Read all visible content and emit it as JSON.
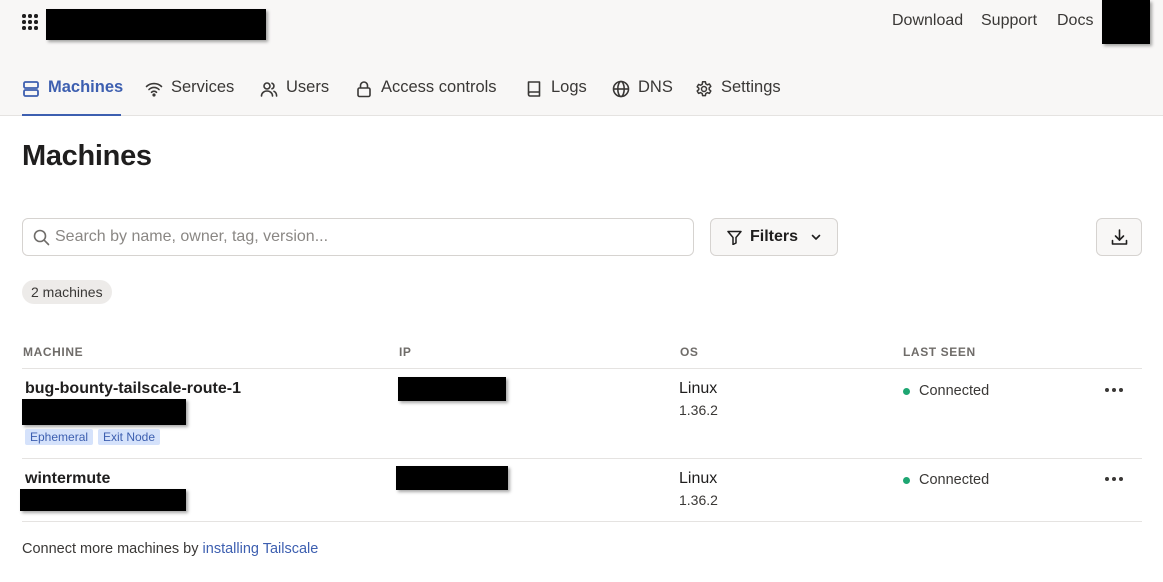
{
  "topbar": {
    "links": [
      "Download",
      "Support",
      "Docs"
    ]
  },
  "nav": {
    "items": [
      {
        "label": "Machines",
        "icon": "machines-icon",
        "active": true
      },
      {
        "label": "Services",
        "icon": "wifi-icon",
        "active": false
      },
      {
        "label": "Users",
        "icon": "users-icon",
        "active": false
      },
      {
        "label": "Access controls",
        "icon": "lock-icon",
        "active": false
      },
      {
        "label": "Logs",
        "icon": "book-icon",
        "active": false
      },
      {
        "label": "DNS",
        "icon": "globe-icon",
        "active": false
      },
      {
        "label": "Settings",
        "icon": "gear-icon",
        "active": false
      }
    ]
  },
  "page": {
    "title": "Machines"
  },
  "toolbar": {
    "search_placeholder": "Search by name, owner, tag, version...",
    "search_value": "",
    "filters_label": "Filters"
  },
  "summary": {
    "count_label": "2 machines"
  },
  "table": {
    "headers": {
      "machine": "MACHINE",
      "ip": "IP",
      "os": "OS",
      "last_seen": "LAST SEEN"
    },
    "rows": [
      {
        "name": "bug-bounty-tailscale-route-1",
        "tags": [
          "Ephemeral",
          "Exit Node"
        ],
        "os": "Linux",
        "version": "1.36.2",
        "status": "Connected"
      },
      {
        "name": "wintermute",
        "tags": [],
        "os": "Linux",
        "version": "1.36.2",
        "status": "Connected"
      }
    ]
  },
  "footer": {
    "text": "Connect more machines by",
    "link_label": "installing Tailscale"
  },
  "colors": {
    "accent": "#3d5fb0",
    "connected": "#1ea672",
    "tag_bg": "#d5e2fb"
  }
}
